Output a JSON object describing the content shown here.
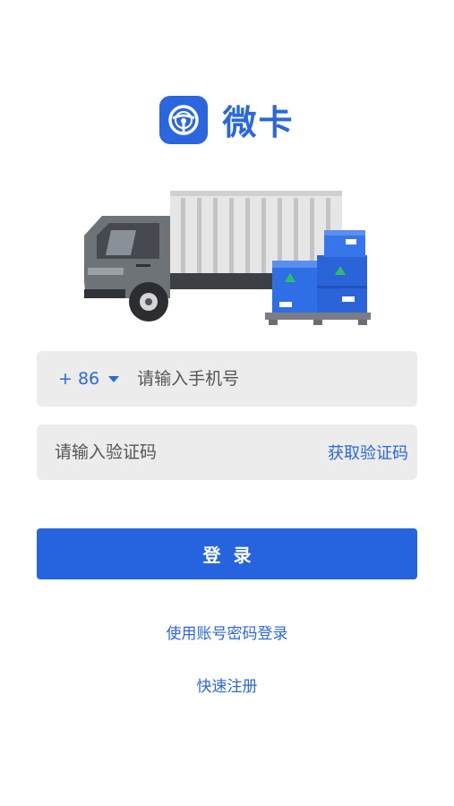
{
  "app": {
    "name": "微卡"
  },
  "login_form": {
    "country_code": "+ 86",
    "phone_placeholder": "请输入手机号",
    "code_placeholder": "请输入验证码",
    "get_code_label": "获取验证码",
    "login_label": "登录"
  },
  "links": {
    "password_login": "使用账号密码登录",
    "register": "快速注册"
  },
  "colors": {
    "brand": "#2a67df",
    "field_bg": "#ececec"
  },
  "icons": {
    "logo": "steering-wheel-icon",
    "country_dropdown": "chevron-down-icon",
    "illustration": "truck-with-boxes"
  }
}
